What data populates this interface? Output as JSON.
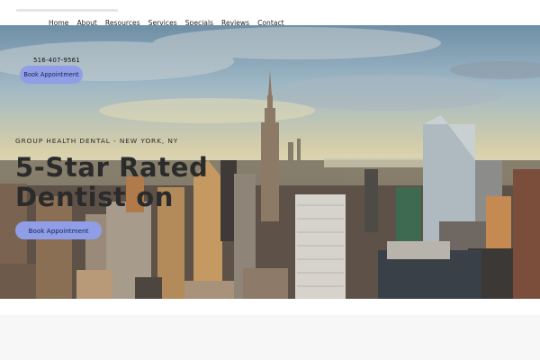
{
  "nav": {
    "items": [
      "Home",
      "About",
      "Resources",
      "Services",
      "Specials",
      "Reviews",
      "Contact"
    ]
  },
  "header": {
    "phone": "516-407-9561",
    "book_button": "Book Appointment"
  },
  "hero": {
    "kicker": "GROUP HEALTH DENTAL - NEW YORK, NY",
    "headline": "5-Star Rated Dentist on",
    "cta_button": "Book Appointment"
  },
  "colors": {
    "accent_button": "#8f9ee6",
    "heading_text": "#2b2b2b",
    "footer_band": "#f7f7f7"
  },
  "icons": {
    "hero_background": "city-skyline-image"
  }
}
